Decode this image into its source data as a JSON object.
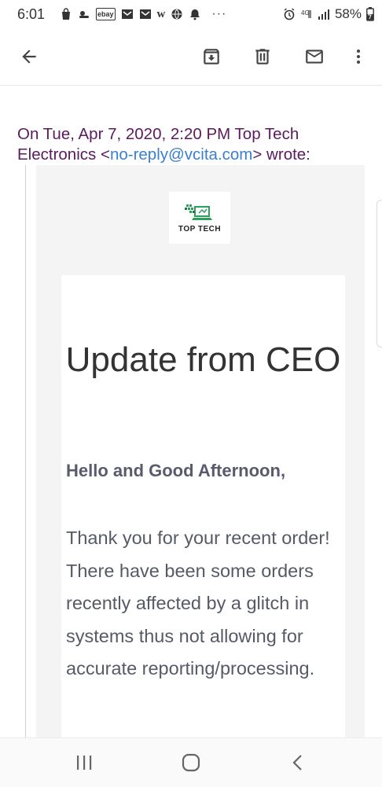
{
  "status_bar": {
    "time": "6:01",
    "battery": "58%",
    "notification_icons": [
      "bag-icon",
      "weather-icon",
      "ebay-icon",
      "gmail-icon",
      "gmail-icon",
      "w-icon",
      "globe-icon",
      "alert-icon",
      "more-dots"
    ],
    "ebay_label": "ebay",
    "w_label": "w",
    "more_dots": "···"
  },
  "toolbar": {
    "icons": [
      "back-arrow-icon",
      "archive-icon",
      "delete-icon",
      "mail-icon",
      "more-vert-icon"
    ]
  },
  "email": {
    "quote_prefix": "On Tue, Apr 7, 2020, 2:20 PM Top Tech Electronics <",
    "sender_email": "no-reply@vcita.com",
    "quote_suffix": "> wrote:",
    "logo_text": "TOP TECH",
    "title": "Update from CEO",
    "greeting": "Hello and Good Afternoon,",
    "body": "Thank you for your recent order! There have been some orders recently affected by a glitch in systems thus not allowing for accurate reporting/processing."
  },
  "colors": {
    "quote_header": "#5b1a5f",
    "link": "#3b7fd1",
    "email_bg": "#f4f4f4",
    "logo_green": "#2aa05a"
  },
  "navbar": {
    "buttons": [
      "recent-apps-icon",
      "home-icon",
      "back-icon"
    ]
  }
}
